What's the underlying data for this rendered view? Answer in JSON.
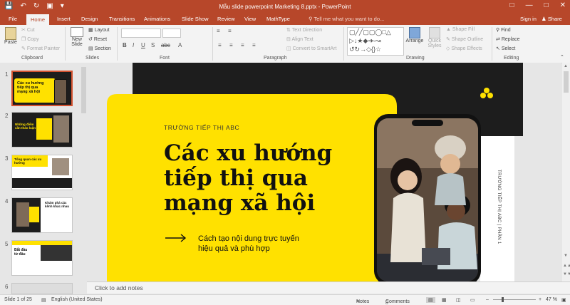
{
  "window": {
    "title": "Mẫu slide powerpoint Marketing 8.pptx - PowerPoint"
  },
  "tabs": [
    "File",
    "Home",
    "Insert",
    "Design",
    "Transitions",
    "Animations",
    "Slide Show",
    "Review",
    "View",
    "MathType"
  ],
  "tell_me": "Tell me what you want to do...",
  "sign_in": "Sign in",
  "share": "Share",
  "ribbon": {
    "clipboard": {
      "paste": "Paste",
      "cut": "Cut",
      "copy": "Copy",
      "format_painter": "Format Painter",
      "label": "Clipboard"
    },
    "slides": {
      "new_slide": "New",
      "new_slide2": "Slide",
      "layout": "Layout",
      "reset": "Reset",
      "section": "Section",
      "label": "Slides"
    },
    "font": {
      "label": "Font"
    },
    "paragraph": {
      "text_direction": "Text Direction",
      "align_text": "Align Text",
      "convert": "Convert to SmartArt",
      "label": "Paragraph"
    },
    "drawing": {
      "arrange": "Arrange",
      "quick_styles": "Quick",
      "quick_styles2": "Styles",
      "shape_fill": "Shape Fill",
      "shape_outline": "Shape Outline",
      "shape_effects": "Shape Effects",
      "label": "Drawing"
    },
    "editing": {
      "find": "Find",
      "replace": "Replace",
      "select": "Select",
      "label": "Editing"
    }
  },
  "thumbnails": [
    {
      "num": "1",
      "title": "Các xu hướng tiếp thị qua mạng xã hội"
    },
    {
      "num": "2",
      "title": "Những điểm cần thảo luận"
    },
    {
      "num": "3",
      "title": "Tổng quan các xu hướng"
    },
    {
      "num": "4",
      "title": "Khám phá các kênh khác nhau"
    },
    {
      "num": "5",
      "title": "Bắt đầu từ đâu"
    },
    {
      "num": "6",
      "title": ""
    }
  ],
  "slide": {
    "eyebrow": "TRƯỜNG TIẾP THỊ ABC",
    "title_l1": "Các xu hướng",
    "title_l2": "tiếp thị qua",
    "title_l3": "mạng xã hội",
    "sub_l1": "Cách tạo nội dung trực tuyến",
    "sub_l2": "hiệu quả và phù hợp",
    "side_text": "TRƯỜNG TIẾP THỊ ABC | PHẦN 1"
  },
  "notes_placeholder": "Click to add notes",
  "status": {
    "slide": "Slide 1 of 25",
    "language": "English (United States)",
    "notes": "Notes",
    "comments": "Comments",
    "zoom": "47 %"
  },
  "colors": {
    "accent": "#b7472a",
    "yellow": "#ffe100",
    "dark": "#1d1d1d"
  }
}
